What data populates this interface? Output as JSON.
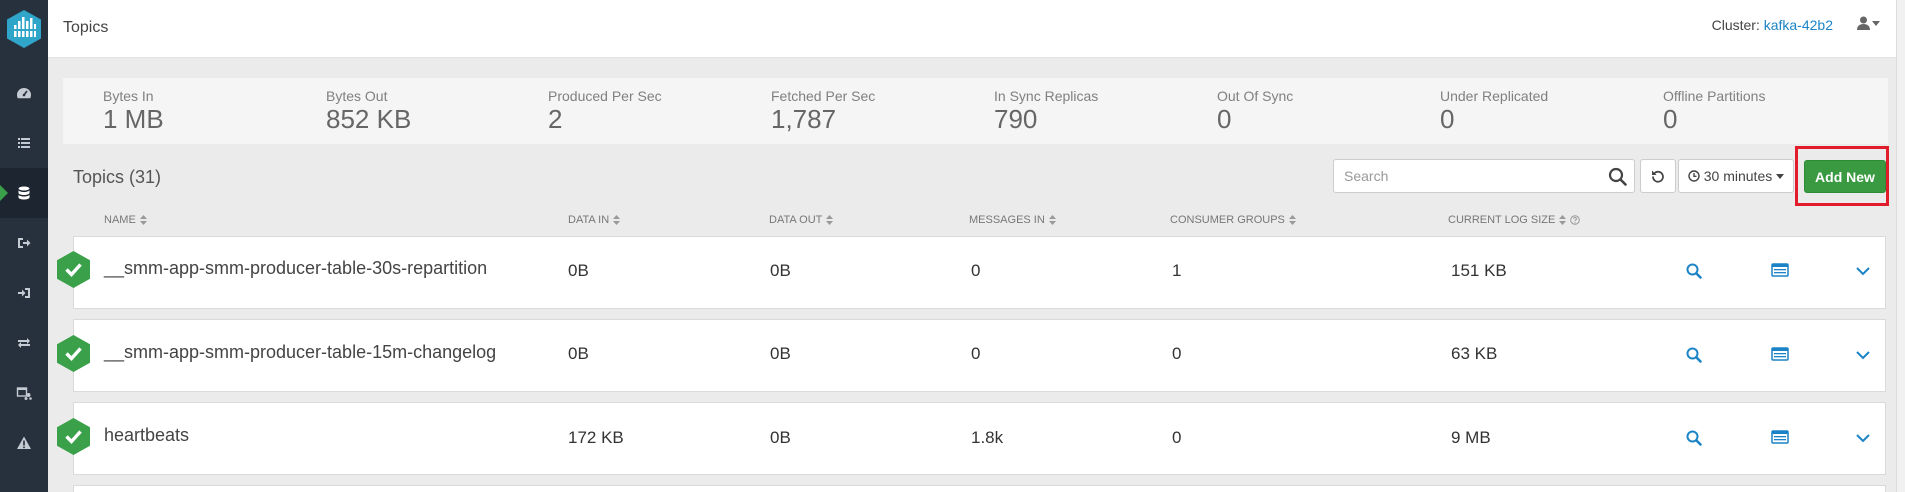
{
  "header": {
    "title": "Topics",
    "cluster_label": "Cluster:",
    "cluster_name": "kafka-42b2"
  },
  "sidebar": {
    "items": [
      {
        "icon": "dashboard-icon"
      },
      {
        "icon": "list-icon"
      },
      {
        "icon": "database-icon",
        "active": true
      },
      {
        "icon": "sign-out-icon"
      },
      {
        "icon": "sign-in-icon"
      },
      {
        "icon": "exchange-icon"
      },
      {
        "icon": "network-icon"
      },
      {
        "icon": "warning-icon"
      }
    ]
  },
  "metrics": [
    {
      "label": "Bytes In",
      "value": "1 MB"
    },
    {
      "label": "Bytes Out",
      "value": "852 KB"
    },
    {
      "label": "Produced Per Sec",
      "value": "2"
    },
    {
      "label": "Fetched Per Sec",
      "value": "1,787"
    },
    {
      "label": "In Sync Replicas",
      "value": "790"
    },
    {
      "label": "Out Of Sync",
      "value": "0"
    },
    {
      "label": "Under Replicated",
      "value": "0"
    },
    {
      "label": "Offline Partitions",
      "value": "0"
    }
  ],
  "toolbar": {
    "heading": "Topics (31)",
    "search_placeholder": "Search",
    "search_value": "",
    "time_range": "30 minutes",
    "add_new_label": "Add New"
  },
  "columns": [
    {
      "label": "NAME"
    },
    {
      "label": "DATA IN"
    },
    {
      "label": "DATA OUT"
    },
    {
      "label": "MESSAGES IN"
    },
    {
      "label": "CONSUMER GROUPS"
    },
    {
      "label": "CURRENT LOG SIZE"
    }
  ],
  "rows": [
    {
      "name": "__smm-app-smm-producer-table-30s-repartition",
      "data_in": "0B",
      "data_out": "0B",
      "messages_in": "0",
      "consumer_groups": "1",
      "log_size": "151 KB"
    },
    {
      "name": "__smm-app-smm-producer-table-15m-changelog",
      "data_in": "0B",
      "data_out": "0B",
      "messages_in": "0",
      "consumer_groups": "0",
      "log_size": "63 KB"
    },
    {
      "name": "heartbeats",
      "data_in": "172 KB",
      "data_out": "0B",
      "messages_in": "1.8k",
      "consumer_groups": "0",
      "log_size": "9 MB"
    }
  ],
  "colors": {
    "sidebar_bg": "#27303d",
    "accent_green": "#3a9a42",
    "link_blue": "#1c84c6",
    "highlight_red": "#e21d2b"
  }
}
